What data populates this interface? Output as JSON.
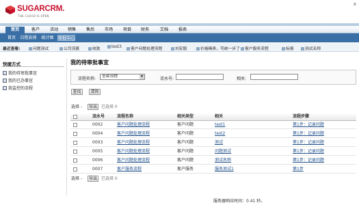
{
  "app": {
    "brand": "SUGARCRM.",
    "tagline": "THE CLOUD IS OPEN",
    "close_glyph": "x",
    "brand_color": "#c8102e",
    "accent": "#3a6fa6"
  },
  "tabs": [
    "首页",
    "客户",
    "活动",
    "销售",
    "售后",
    "市场",
    "项目",
    "财务",
    "文档",
    "报表"
  ],
  "subtabs": [
    "首页",
    "日程安排",
    "统计图",
    "审批中心"
  ],
  "recent": {
    "label": "最近查看:",
    "items": [
      "问题测试",
      "公司流套",
      "收款",
      "test3",
      "客户问题处理流程",
      "刘宏毅",
      "价格精贵，可统一步了",
      "客户服务流程",
      "标报",
      "测试名称"
    ]
  },
  "sidebar": {
    "title": "快捷方式",
    "items": [
      "我的待审批事宜",
      "我的已办事宜",
      "我监控的流程"
    ]
  },
  "main": {
    "title": "我的待审批事宜",
    "search": {
      "flow_label": "流程名称:",
      "flow_value": "全部流程",
      "serial_label": "流水号:",
      "related_label": "相关:",
      "search_btn": "查找",
      "clear_btn": "清除"
    },
    "pager_top": {
      "select_label": "选择 -",
      "export_btn": "导出",
      "selected": "已选择 0"
    },
    "pager_bottom": {
      "select_label": "选择 -",
      "export_btn": "导出",
      "selected": "已选择 0"
    },
    "columns": [
      "流水号",
      "流程名称",
      "相关类型",
      "相关",
      "流程步骤"
    ],
    "rows": [
      {
        "serial": "0002",
        "flow": "客户问题处理流程",
        "type": "客户问题",
        "related": "test1",
        "step": "第1步：记录问题"
      },
      {
        "serial": "0004",
        "flow": "客户问题处理流程",
        "type": "客户问题",
        "related": "test2",
        "step": "第1步：记录问题"
      },
      {
        "serial": "0003",
        "flow": "客户问题处理流程",
        "type": "客户问题",
        "related": "测试",
        "step": "第1步：记录问题"
      },
      {
        "serial": "0005",
        "flow": "客户问题处理流程",
        "type": "客户问题",
        "related": "问题测试",
        "step": "第1步：记录问题"
      },
      {
        "serial": "0006",
        "flow": "客户问题处理流程",
        "type": "客户问题",
        "related": "测试名称",
        "step": "第1步：记录问题"
      },
      {
        "serial": "0007",
        "flow": "客户服务流程",
        "type": "客户服务",
        "related": "服务测试1",
        "step": "第1步"
      }
    ]
  },
  "footer": {
    "text": "服务器响应时间：0.41 秒。"
  }
}
